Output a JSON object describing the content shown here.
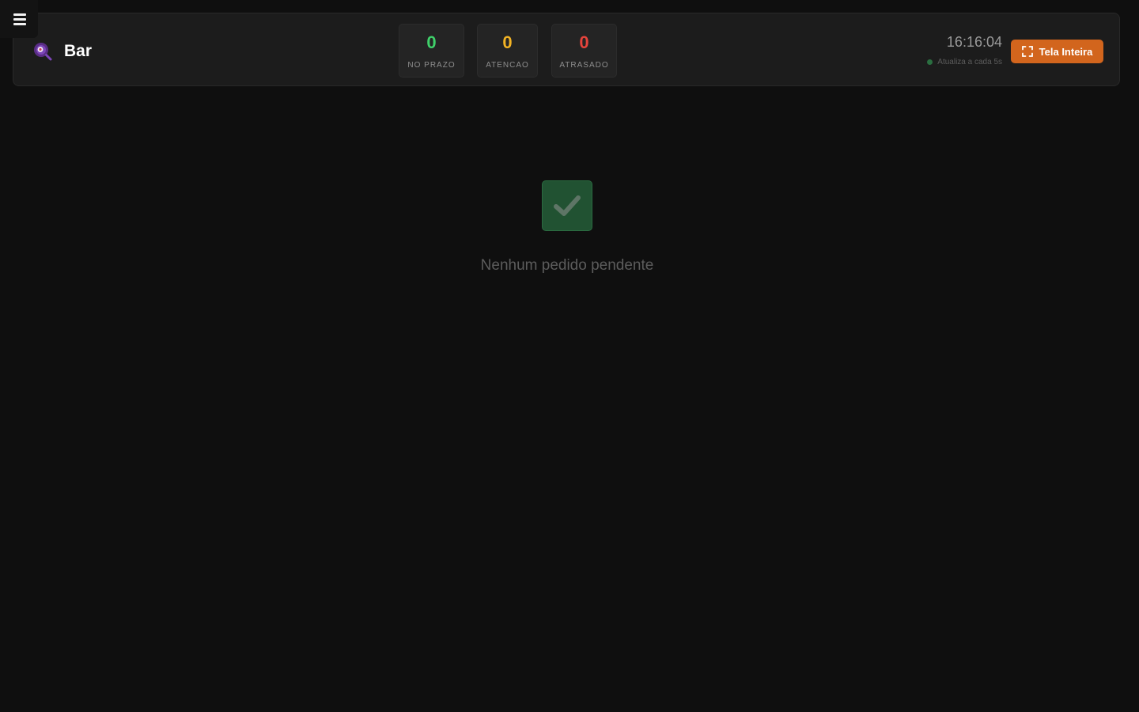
{
  "menu": {
    "icon": "hamburger-menu-icon"
  },
  "header": {
    "title": "Bar",
    "icon": "bar-logo-icon",
    "stats": [
      {
        "value": "0",
        "label": "NO PRAZO",
        "color": "#3fd16a"
      },
      {
        "value": "0",
        "label": "ATENCAO",
        "color": "#f2b324"
      },
      {
        "value": "0",
        "label": "ATRASADO",
        "color": "#e5443c"
      }
    ],
    "clock": "16:16:04",
    "refresh_text": "Atualiza a cada 5s",
    "fullscreen_label": "Tela Inteira",
    "fullscreen_icon": "fullscreen-icon"
  },
  "empty_state": {
    "icon": "checkmark-icon",
    "message": "Nenhum pedido pendente"
  },
  "colors": {
    "accent": "#d2651d",
    "success": "#215232",
    "background": "#0f0f0f"
  }
}
